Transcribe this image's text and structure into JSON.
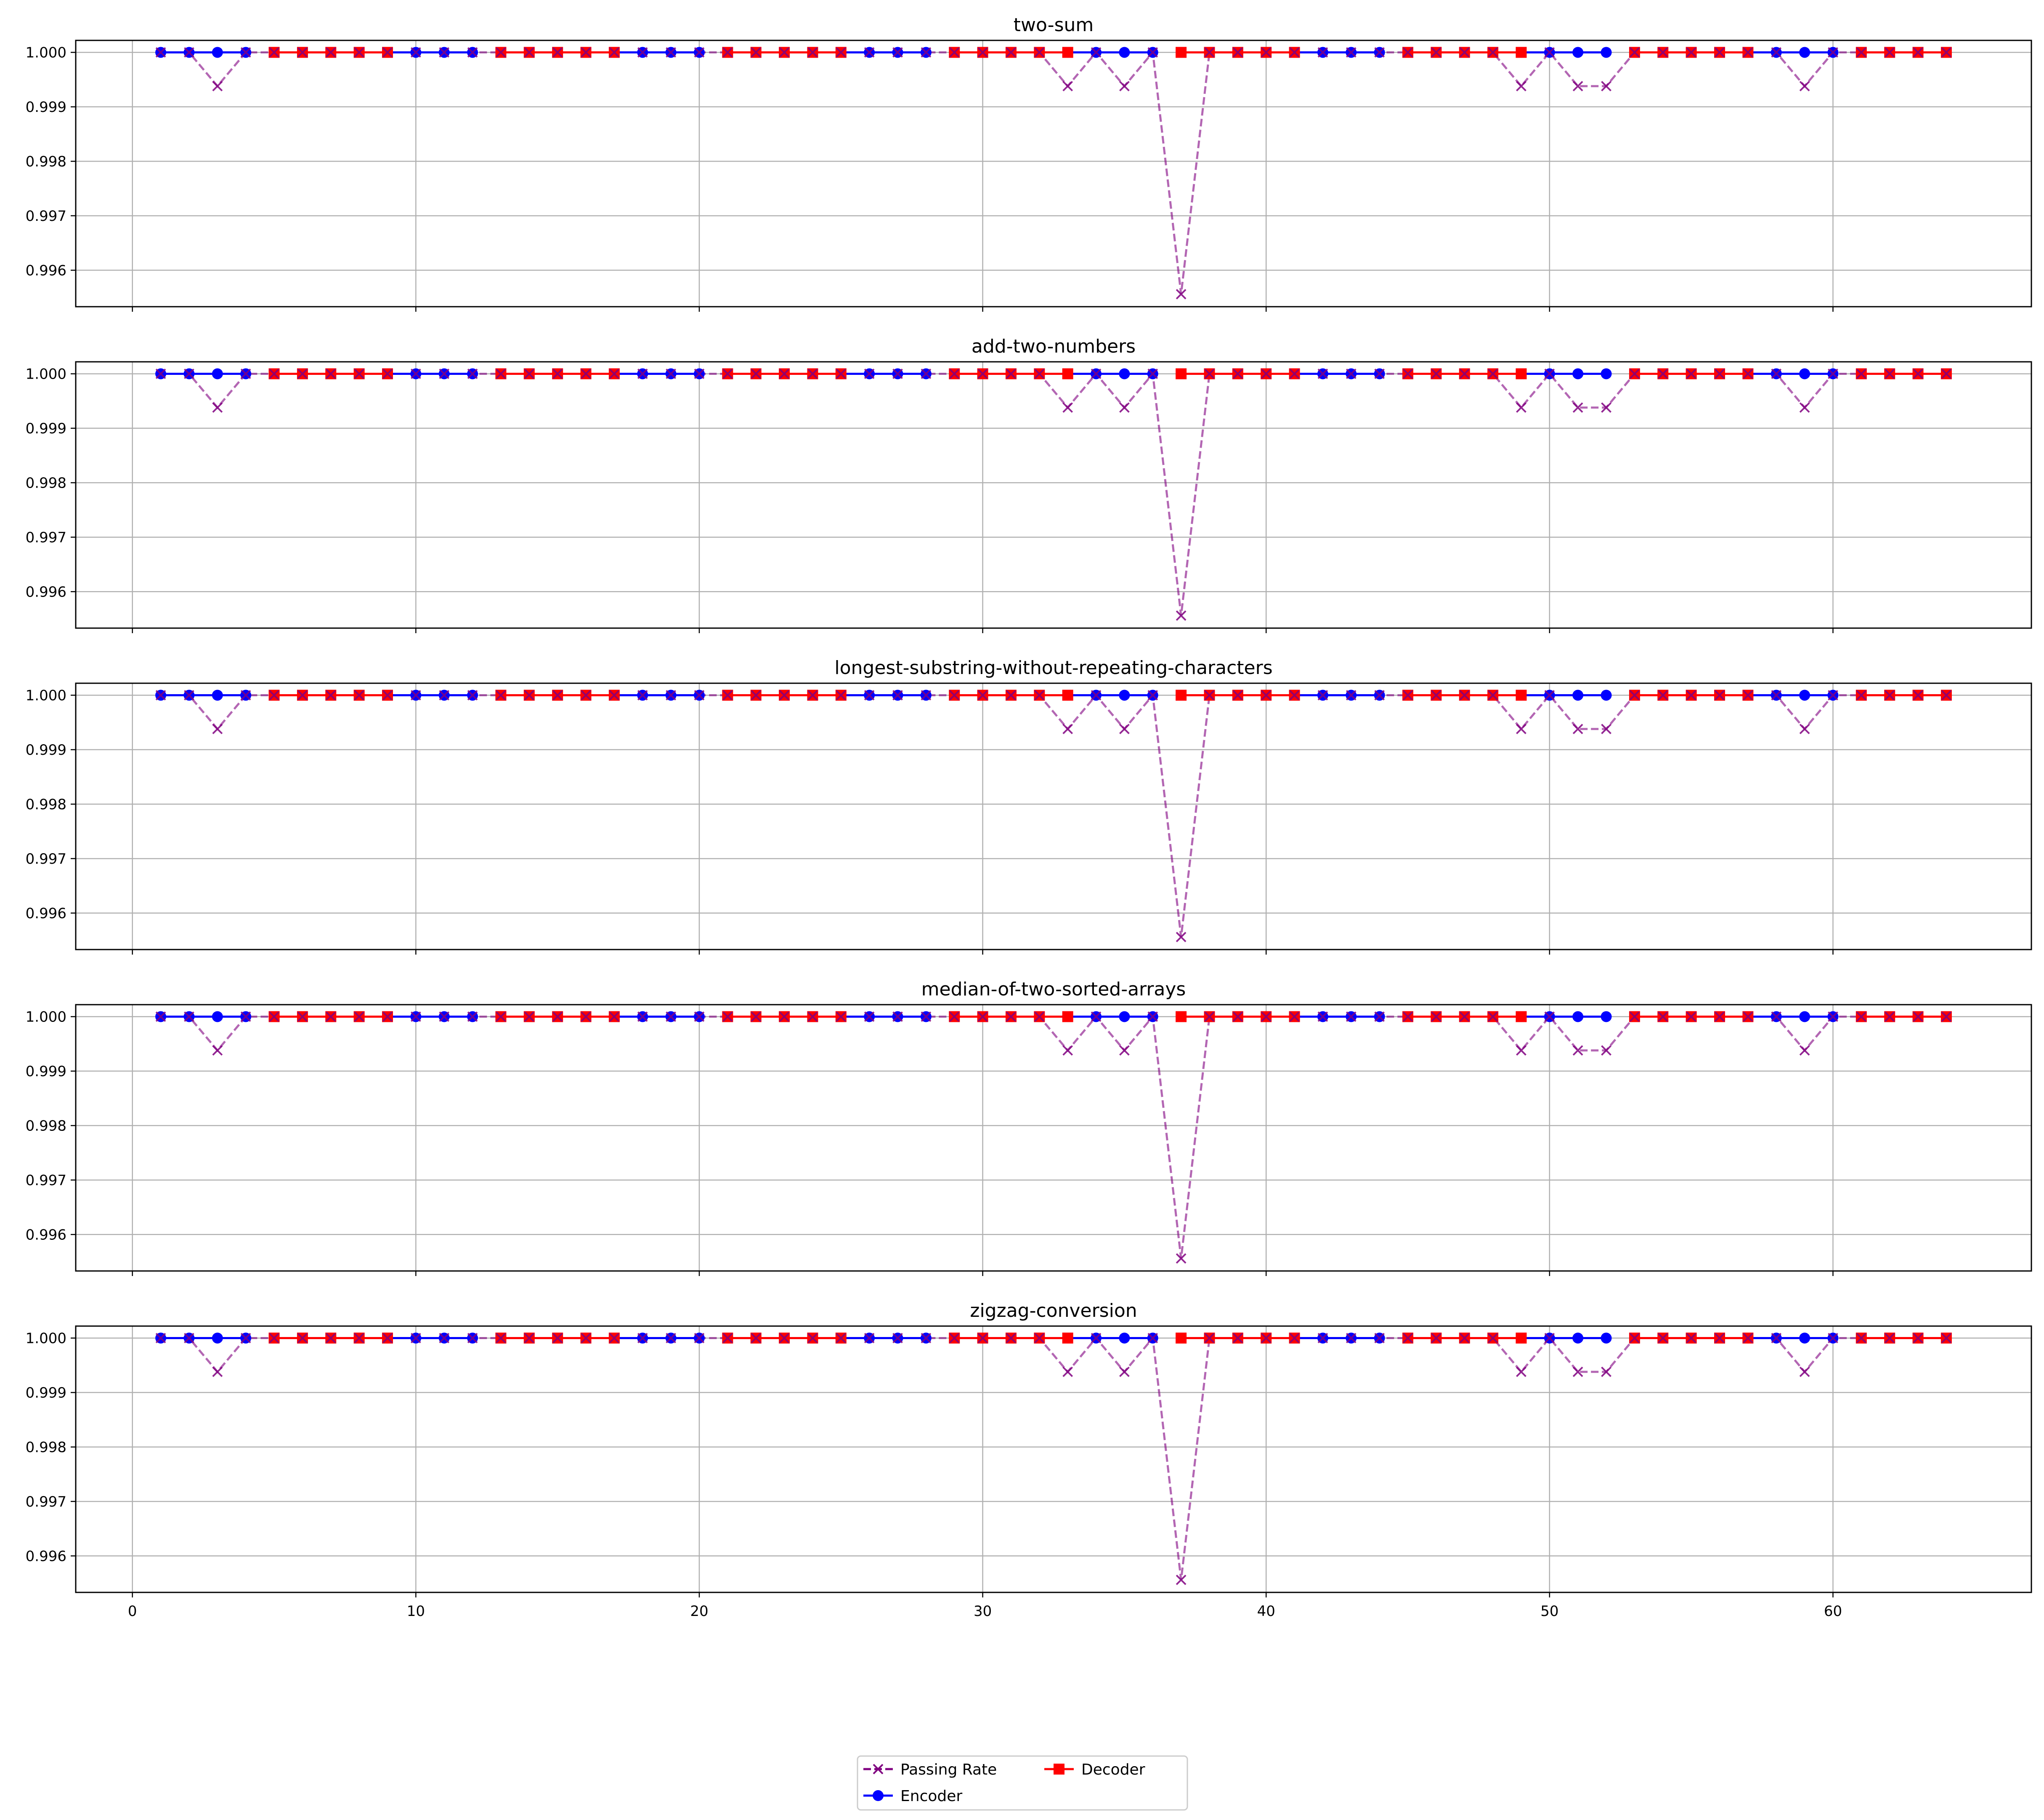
{
  "colors": {
    "passing": "#800080",
    "encoder": "#0000ff",
    "decoder": "#ff0000",
    "grid": "#b0b0b0",
    "frame": "#000000"
  },
  "legend": {
    "passing_label": "Passing Rate",
    "encoder_label": "Encoder",
    "decoder_label": "Decoder",
    "placement": "bottom-center"
  },
  "chart_data": [
    {
      "type": "line",
      "title": "two-sum"
    },
    {
      "type": "line",
      "title": "add-two-numbers"
    },
    {
      "type": "line",
      "title": "longest-substring-without-repeating-characters"
    },
    {
      "type": "line",
      "title": "median-of-two-sorted-arrays"
    },
    {
      "type": "line",
      "title": "zigzag-conversion"
    }
  ],
  "shared": {
    "type": "line",
    "sharex": true,
    "grid": true,
    "xlim": [
      -2,
      67
    ],
    "xticks": [
      0,
      10,
      20,
      30,
      40,
      50,
      60
    ],
    "ylim": [
      0.99533,
      1.00022
    ],
    "yticks": [
      0.996,
      0.997,
      0.998,
      0.999,
      1.0
    ],
    "ytick_labels": [
      "0.996",
      "0.997",
      "0.998",
      "0.999",
      "1.000"
    ],
    "layers": [
      1,
      2,
      3,
      4,
      5,
      6,
      7,
      8,
      9,
      10,
      11,
      12,
      13,
      14,
      15,
      16,
      17,
      18,
      19,
      20,
      21,
      22,
      23,
      24,
      25,
      26,
      27,
      28,
      29,
      30,
      31,
      32,
      33,
      34,
      35,
      36,
      37,
      38,
      39,
      40,
      41,
      42,
      43,
      44,
      45,
      46,
      47,
      48,
      49,
      50,
      51,
      52,
      53,
      54,
      55,
      56,
      57,
      58,
      59,
      60,
      61,
      62,
      63,
      64
    ],
    "passing_rate": [
      1.0,
      1.0,
      0.99938,
      1.0,
      1.0,
      1.0,
      1.0,
      1.0,
      1.0,
      1.0,
      1.0,
      1.0,
      1.0,
      1.0,
      1.0,
      1.0,
      1.0,
      1.0,
      1.0,
      1.0,
      1.0,
      1.0,
      1.0,
      1.0,
      1.0,
      1.0,
      1.0,
      1.0,
      1.0,
      1.0,
      1.0,
      1.0,
      0.99938,
      1.0,
      0.99938,
      1.0,
      0.99556,
      1.0,
      1.0,
      1.0,
      1.0,
      1.0,
      1.0,
      1.0,
      1.0,
      1.0,
      1.0,
      1.0,
      0.99938,
      1.0,
      0.99938,
      0.99938,
      1.0,
      1.0,
      1.0,
      1.0,
      1.0,
      1.0,
      0.99938,
      1.0,
      1.0,
      1.0,
      1.0,
      1.0
    ],
    "encoder_layers": [
      1,
      2,
      3,
      4,
      9,
      10,
      11,
      12,
      17,
      18,
      19,
      20,
      25,
      26,
      27,
      28,
      33,
      34,
      35,
      36,
      41,
      42,
      43,
      44,
      49,
      50,
      51,
      52,
      57,
      58,
      59,
      60
    ],
    "decoder_layers": [
      5,
      6,
      7,
      8,
      9,
      13,
      14,
      15,
      16,
      17,
      21,
      22,
      23,
      24,
      25,
      29,
      30,
      31,
      32,
      33,
      37,
      38,
      39,
      40,
      41,
      45,
      46,
      47,
      48,
      49,
      53,
      54,
      55,
      56,
      57,
      61,
      62,
      63,
      64
    ],
    "component_value": 1.0
  }
}
